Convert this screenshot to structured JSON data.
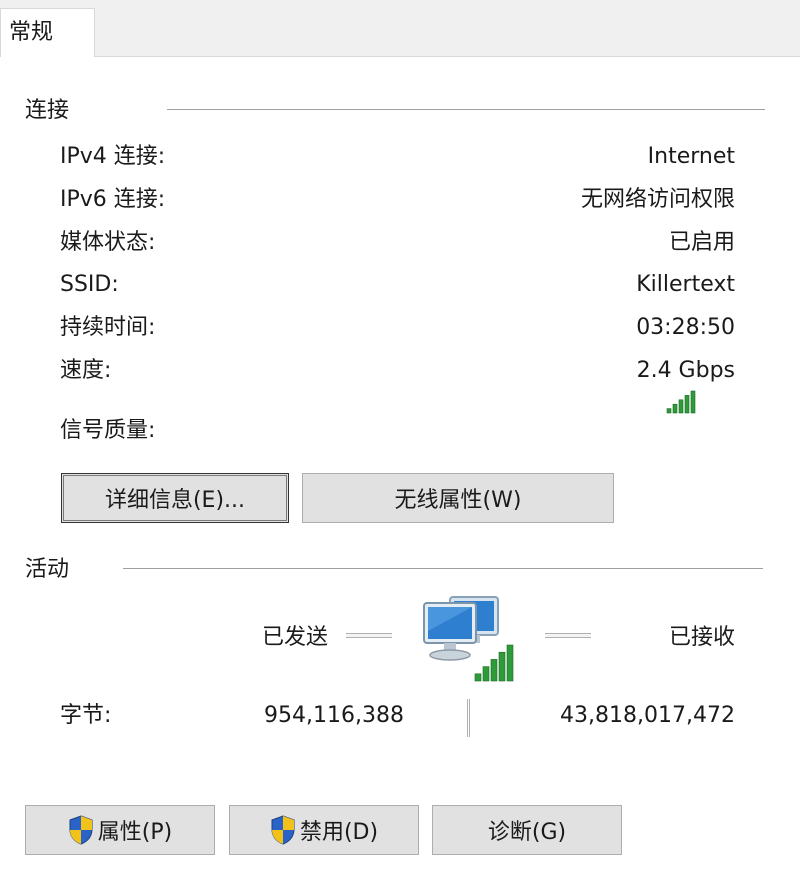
{
  "tab": {
    "label": "常规"
  },
  "connection": {
    "title": "连接",
    "rows": [
      {
        "label": "IPv4 连接:",
        "value": "Internet"
      },
      {
        "label": "IPv6 连接:",
        "value": "无网络访问权限"
      },
      {
        "label": "媒体状态:",
        "value": "已启用"
      },
      {
        "label": "SSID:",
        "value": "Killertext"
      },
      {
        "label": "持续时间:",
        "value": "03:28:50"
      },
      {
        "label": "速度:",
        "value": "2.4 Gbps"
      }
    ],
    "signal_label": "信号质量:",
    "signal_bars": 5,
    "signal_max": 5
  },
  "buttons_top": {
    "details": "详细信息(E)...",
    "wireless": "无线属性(W)"
  },
  "activity": {
    "title": "活动",
    "sent_label": "已发送",
    "received_label": "已接收",
    "bytes_label": "字节:",
    "bytes_sent": "954,116,388",
    "bytes_received": "43,818,017,472"
  },
  "buttons_bottom": {
    "properties": "属性(P)",
    "disable": "禁用(D)",
    "diagnose": "诊断(G)"
  },
  "colors": {
    "signal_green": "#2e9b3a",
    "monitor_blue": "#2f7fd0",
    "shield_blue": "#2a63c8",
    "shield_yellow": "#f2c21b"
  },
  "icons": [
    "shield-icon",
    "network-computers-icon",
    "signal-strength-icon"
  ]
}
